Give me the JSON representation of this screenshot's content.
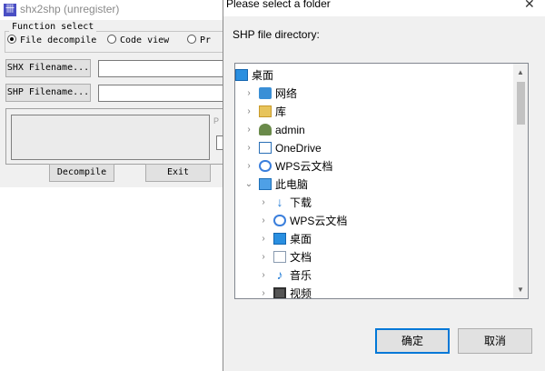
{
  "main_window": {
    "title": "shx2shp (unregister)",
    "app_icon_glyph": "卌",
    "function_select": {
      "legend": "Function select",
      "options": [
        {
          "label": "File decompile",
          "selected": true
        },
        {
          "label": "Code view",
          "selected": false
        },
        {
          "label": "Pr",
          "selected": false
        }
      ]
    },
    "shx_filename_button": "SHX Filename...",
    "shp_filename_button": "SHP Filename...",
    "shx_filename_value": "",
    "shp_filename_value": "",
    "side_label": "P",
    "decompile_button": "Decompile",
    "exit_button": "Exit"
  },
  "folder_dialog": {
    "title": "Please select a folder",
    "close_glyph": "✕",
    "label": "SHP file directory:",
    "tree": [
      {
        "label": "桌面",
        "icon": "desktop-icon",
        "level": 0,
        "state": "none"
      },
      {
        "label": "网络",
        "icon": "network-icon",
        "level": 1,
        "state": "collapsed"
      },
      {
        "label": "库",
        "icon": "library-icon",
        "level": 1,
        "state": "collapsed"
      },
      {
        "label": "admin",
        "icon": "user-icon",
        "level": 1,
        "state": "collapsed"
      },
      {
        "label": "OneDrive",
        "icon": "onedrive-icon",
        "level": 1,
        "state": "collapsed"
      },
      {
        "label": "WPS云文档",
        "icon": "cloud-icon",
        "level": 1,
        "state": "collapsed"
      },
      {
        "label": "此电脑",
        "icon": "computer-icon",
        "level": 1,
        "state": "expanded"
      },
      {
        "label": "下载",
        "icon": "download-icon",
        "level": 2,
        "state": "collapsed"
      },
      {
        "label": "WPS云文档",
        "icon": "cloud-icon",
        "level": 2,
        "state": "collapsed"
      },
      {
        "label": "桌面",
        "icon": "desktop-icon",
        "level": 2,
        "state": "collapsed"
      },
      {
        "label": "文档",
        "icon": "document-icon",
        "level": 2,
        "state": "collapsed"
      },
      {
        "label": "音乐",
        "icon": "music-icon",
        "level": 2,
        "state": "collapsed"
      },
      {
        "label": "视频",
        "icon": "video-icon",
        "level": 2,
        "state": "collapsed"
      }
    ],
    "ok_button": "确定",
    "cancel_button": "取消",
    "accent_color": "#0078d7"
  }
}
